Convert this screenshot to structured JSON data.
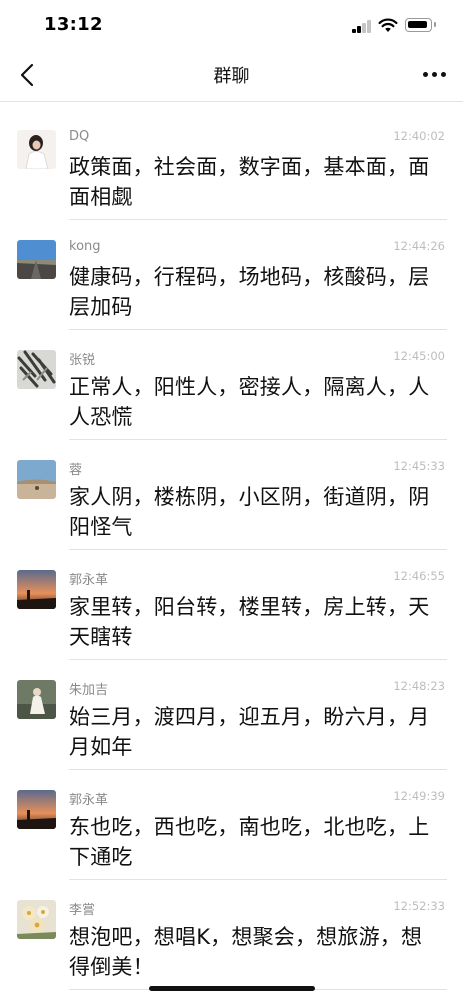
{
  "status": {
    "time": "13:12"
  },
  "header": {
    "title": "群聊",
    "back_icon": "chevron-left-icon",
    "more_icon": "more-dots-icon"
  },
  "messages": [
    {
      "sender": "DQ",
      "time": "12:40:02",
      "text": "政策面，社会面，数字面，基本面，面面相觑"
    },
    {
      "sender": "kong",
      "time": "12:44:26",
      "text": "健康码，行程码，场地码，核酸码，层层加码"
    },
    {
      "sender": "张锐",
      "time": "12:45:00",
      "text": "正常人，阳性人，密接人，隔离人，人人恐慌"
    },
    {
      "sender": "蓉",
      "time": "12:45:33",
      "text": "家人阴，楼栋阴，小区阴，街道阴，阴阳怪气"
    },
    {
      "sender": "郭永革",
      "time": "12:46:55",
      "text": "家里转，阳台转，楼里转，房上转，天天瞎转"
    },
    {
      "sender": "朱加吉",
      "time": "12:48:23",
      "text": "始三月，渡四月，迎五月，盼六月，月月如年"
    },
    {
      "sender": "郭永革",
      "time": "12:49:39",
      "text": "东也吃，西也吃，南也吃，北也吃，上下通吃"
    },
    {
      "sender": "李嘗",
      "time": "12:52:33",
      "text": "想泡吧，想唱K，想聚会，想旅游，想得倒美！"
    }
  ]
}
